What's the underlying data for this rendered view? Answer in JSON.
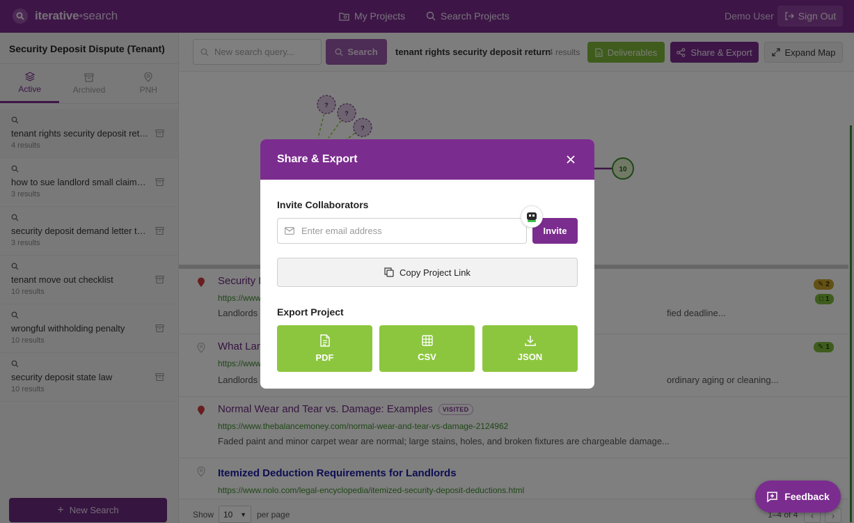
{
  "brand": {
    "name": "iterative",
    "sep": "•",
    "suffix": "search"
  },
  "nav": {
    "my_projects": "My Projects",
    "search_projects": "Search Projects"
  },
  "user": {
    "name": "Demo User",
    "sign_out": "Sign Out"
  },
  "sidebar": {
    "project_title": "Security Deposit Dispute (Tenant)",
    "tabs": [
      {
        "label": "Active",
        "icon": "layers-icon",
        "active": true
      },
      {
        "label": "Archived",
        "icon": "archive-icon",
        "active": false
      },
      {
        "label": "PNH",
        "icon": "map-pin-icon",
        "active": false
      }
    ],
    "searches": [
      {
        "query": "tenant rights security deposit return",
        "count": "4 results",
        "selected": true
      },
      {
        "query": "how to sue landlord small claims court",
        "count": "3 results"
      },
      {
        "query": "security deposit demand letter template",
        "count": "3 results"
      },
      {
        "query": "tenant move out checklist",
        "count": "10 results"
      },
      {
        "query": "wrongful withholding penalty",
        "count": "10 results"
      },
      {
        "query": "security deposit state law",
        "count": "10 results"
      }
    ],
    "new_search": "New Search"
  },
  "toolbar": {
    "search_placeholder": "New search query...",
    "search_button": "Search",
    "current_query": "tenant rights security deposit return",
    "current_count": "4 results",
    "deliverables": "Deliverables",
    "share_export": "Share & Export",
    "expand_map": "Expand Map"
  },
  "map": {
    "unknown_label": "?",
    "node_value": "10"
  },
  "results": [
    {
      "title": "Security D",
      "url": "https://www",
      "snippet": "Landlords",
      "snippet_tail": "fied deadline...",
      "pinned": true,
      "badges": [
        {
          "icon": "thumb-icon",
          "value": "2",
          "color": "gold"
        },
        {
          "icon": "doc-icon",
          "value": "1",
          "color": "green"
        }
      ]
    },
    {
      "title": "What Lan",
      "url": "https://www",
      "snippet": "Landlords",
      "snippet_tail": "ordinary aging or cleaning...",
      "pinned": false,
      "badges": [
        {
          "icon": "thumb-icon",
          "value": "1",
          "color": "green"
        }
      ]
    },
    {
      "title": "Normal Wear and Tear vs. Damage: Examples",
      "visited": "VISITED",
      "url": "https://www.thebalancemoney.com/normal-wear-and-tear-vs-damage-2124962",
      "snippet": "Faded paint and minor carpet wear are normal; large stains, holes, and broken fixtures are chargeable damage...",
      "pinned": true
    },
    {
      "title": "Itemized Deduction Requirements for Landlords",
      "url": "https://www.nolo.com/legal-encyclopedia/itemized-security-deposit-deductions.html",
      "pinned": false
    }
  ],
  "pagination": {
    "show": "Show",
    "per_page_value": "10",
    "per_page": "per page",
    "range": "1–4 of 4",
    "prev": "‹",
    "next": "›"
  },
  "modal": {
    "title": "Share & Export",
    "invite_label": "Invite Collaborators",
    "email_placeholder": "Enter email address",
    "invite_button": "Invite",
    "copy_link": "Copy Project Link",
    "export_label": "Export Project",
    "exports": [
      {
        "label": "PDF",
        "icon": "file-text-icon"
      },
      {
        "label": "CSV",
        "icon": "table-icon"
      },
      {
        "label": "JSON",
        "icon": "download-icon"
      }
    ]
  },
  "feedback": "Feedback",
  "colors": {
    "brand": "#7b2c8f",
    "accent_green": "#8cc63f",
    "link_green": "#3d8f2c",
    "gold": "#c7a02b"
  }
}
